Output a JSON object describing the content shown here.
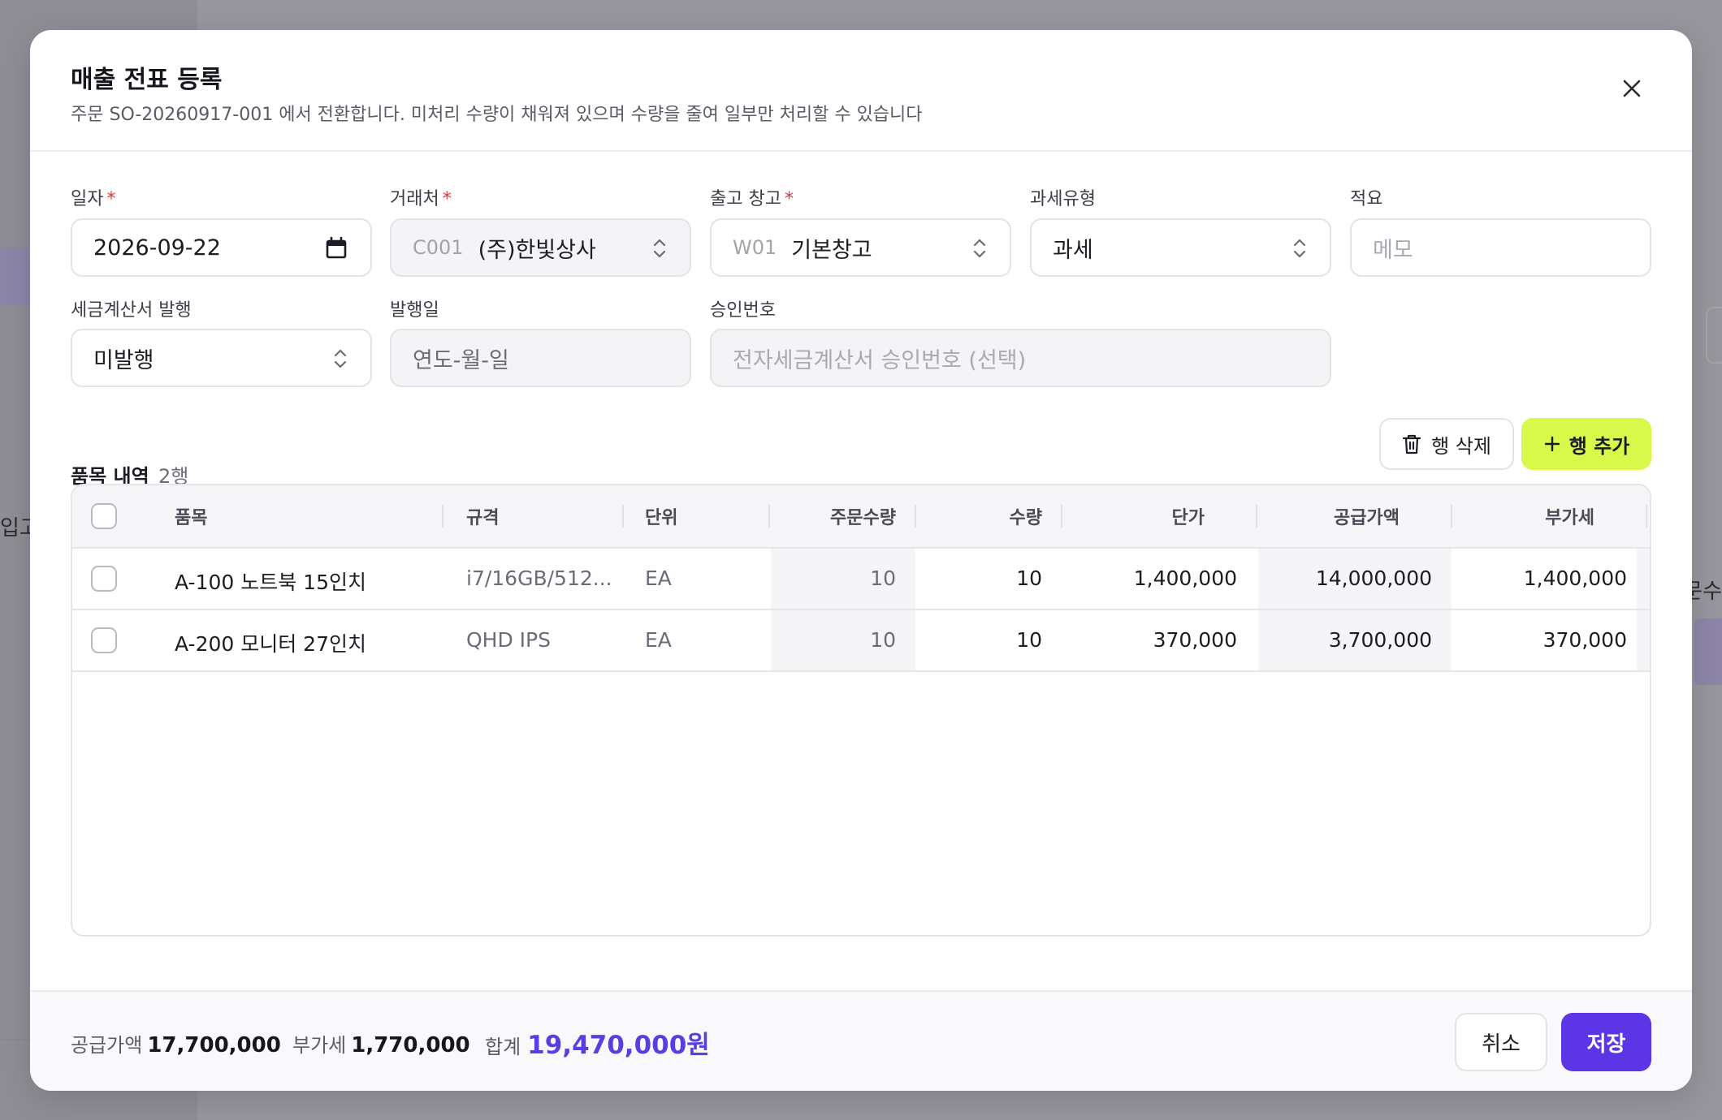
{
  "background": {
    "sidebar_fragment": "입고",
    "right_fragment": "문수"
  },
  "modal": {
    "title": "매출 전표 등록",
    "subtitle": "주문 SO-20260917-001 에서 전환합니다. 미처리 수량이 채워져 있으며 수량을 줄여 일부만 처리할 수 있습니다"
  },
  "form": {
    "date": {
      "label": "일자",
      "value": "2026-09-22",
      "required": true
    },
    "customer": {
      "label": "거래처",
      "code": "C001",
      "value": "(주)한빛상사",
      "required": true
    },
    "warehouse": {
      "label": "출고 창고",
      "code": "W01",
      "value": "기본창고",
      "required": true
    },
    "tax_type": {
      "label": "과세유형",
      "value": "과세"
    },
    "memo": {
      "label": "적요",
      "placeholder": "메모"
    },
    "invoice_issue": {
      "label": "세금계산서 발행",
      "value": "미발행"
    },
    "issue_date": {
      "label": "발행일",
      "placeholder": "연도-월-일"
    },
    "approval_no": {
      "label": "승인번호",
      "placeholder": "전자세금계산서 승인번호 (선택)"
    },
    "required_mark": "*"
  },
  "items": {
    "title": "품목 내역",
    "count": "2행",
    "delete_label": "행 삭제",
    "add_label": "행 추가",
    "columns": [
      "품목",
      "규격",
      "단위",
      "주문수량",
      "수량",
      "단가",
      "공급가액",
      "부가세"
    ],
    "rows": [
      {
        "item": "A-100 노트북 15인치",
        "spec": "i7/16GB/512...",
        "unit": "EA",
        "order_qty": "10",
        "qty": "10",
        "price": "1,400,000",
        "supply": "14,000,000",
        "vat": "1,400,000"
      },
      {
        "item": "A-200 모니터 27인치",
        "spec": "QHD IPS",
        "unit": "EA",
        "order_qty": "10",
        "qty": "10",
        "price": "370,000",
        "supply": "3,700,000",
        "vat": "370,000"
      }
    ]
  },
  "footer": {
    "supply_label": "공급가액",
    "supply_value": "17,700,000",
    "vat_label": "부가세",
    "vat_value": "1,770,000",
    "total_label": "합계",
    "total_value": "19,470,000원",
    "cancel_label": "취소",
    "save_label": "저장"
  },
  "colors": {
    "accent": "#5b35e6",
    "add_button": "#d8f84a",
    "required": "#e0343b"
  }
}
